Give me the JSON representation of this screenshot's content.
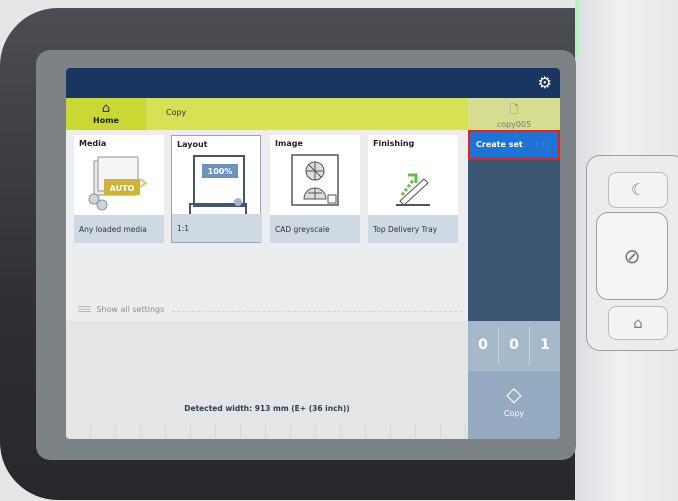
{
  "top_bar": {
    "settings_icon": "gear-icon"
  },
  "nav": {
    "home_label": "Home",
    "home_icon": "house-icon",
    "breadcrumb": "Copy",
    "document_icon": "document-icon",
    "document_name": "copy005"
  },
  "tiles": [
    {
      "title": "Media",
      "value": "Any loaded media",
      "art_label": "AUTO"
    },
    {
      "title": "Layout",
      "value": "1:1",
      "art_label": "100%"
    },
    {
      "title": "Image",
      "value": "CAD greyscale"
    },
    {
      "title": "Finishing",
      "value": "Top Delivery Tray"
    }
  ],
  "show_all_settings": "Show all settings",
  "create_set": "Create set",
  "counter": [
    "0",
    "0",
    "1"
  ],
  "copy_button": "Copy",
  "detected_width": "Detected width: 913 mm (E+ (36 inch))",
  "colors": {
    "navy": "#193660",
    "lime": "#c9d832",
    "blue": "#1e73d6",
    "highlight": "#e2231a"
  }
}
